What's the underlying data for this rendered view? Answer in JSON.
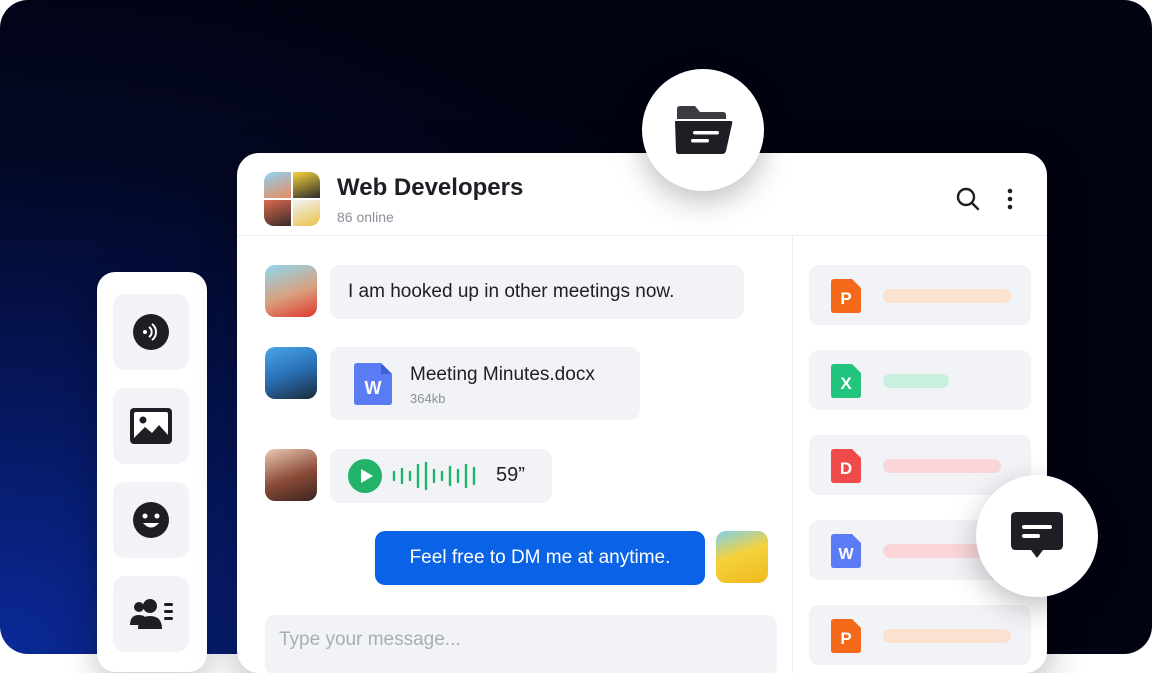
{
  "chat": {
    "title": "Web Developers",
    "online": "86 online",
    "messages": [
      {
        "text": "I am hooked up in other meetings now."
      },
      {
        "file_name": "Meeting Minutes.docx",
        "file_size": "364kb",
        "file_letter": "W"
      },
      {
        "duration": "59”"
      },
      {
        "text": "Feel free to DM me at anytime."
      }
    ],
    "input_placeholder": "Type your message..."
  },
  "files": [
    {
      "letter": "P",
      "color": "#f56a1a",
      "bar_color": "#fbe1cf"
    },
    {
      "letter": "X",
      "color": "#22c47e",
      "bar_color": "#c7f0de"
    },
    {
      "letter": "D",
      "color": "#f04b4b",
      "bar_color": "#fbd6d9"
    },
    {
      "letter": "W",
      "color": "#5b7cf5",
      "bar_color": "#fbd6d9"
    },
    {
      "letter": "P",
      "color": "#f56a1a",
      "bar_color": "#fbe1cf"
    }
  ],
  "colors": {
    "accent": "#0a63e6",
    "audio": "#22b26a"
  },
  "icons": [
    "nfc-icon",
    "image-icon",
    "emoji-icon",
    "contacts-icon",
    "folder-icon",
    "message-icon",
    "search-icon",
    "more-vertical-icon"
  ]
}
